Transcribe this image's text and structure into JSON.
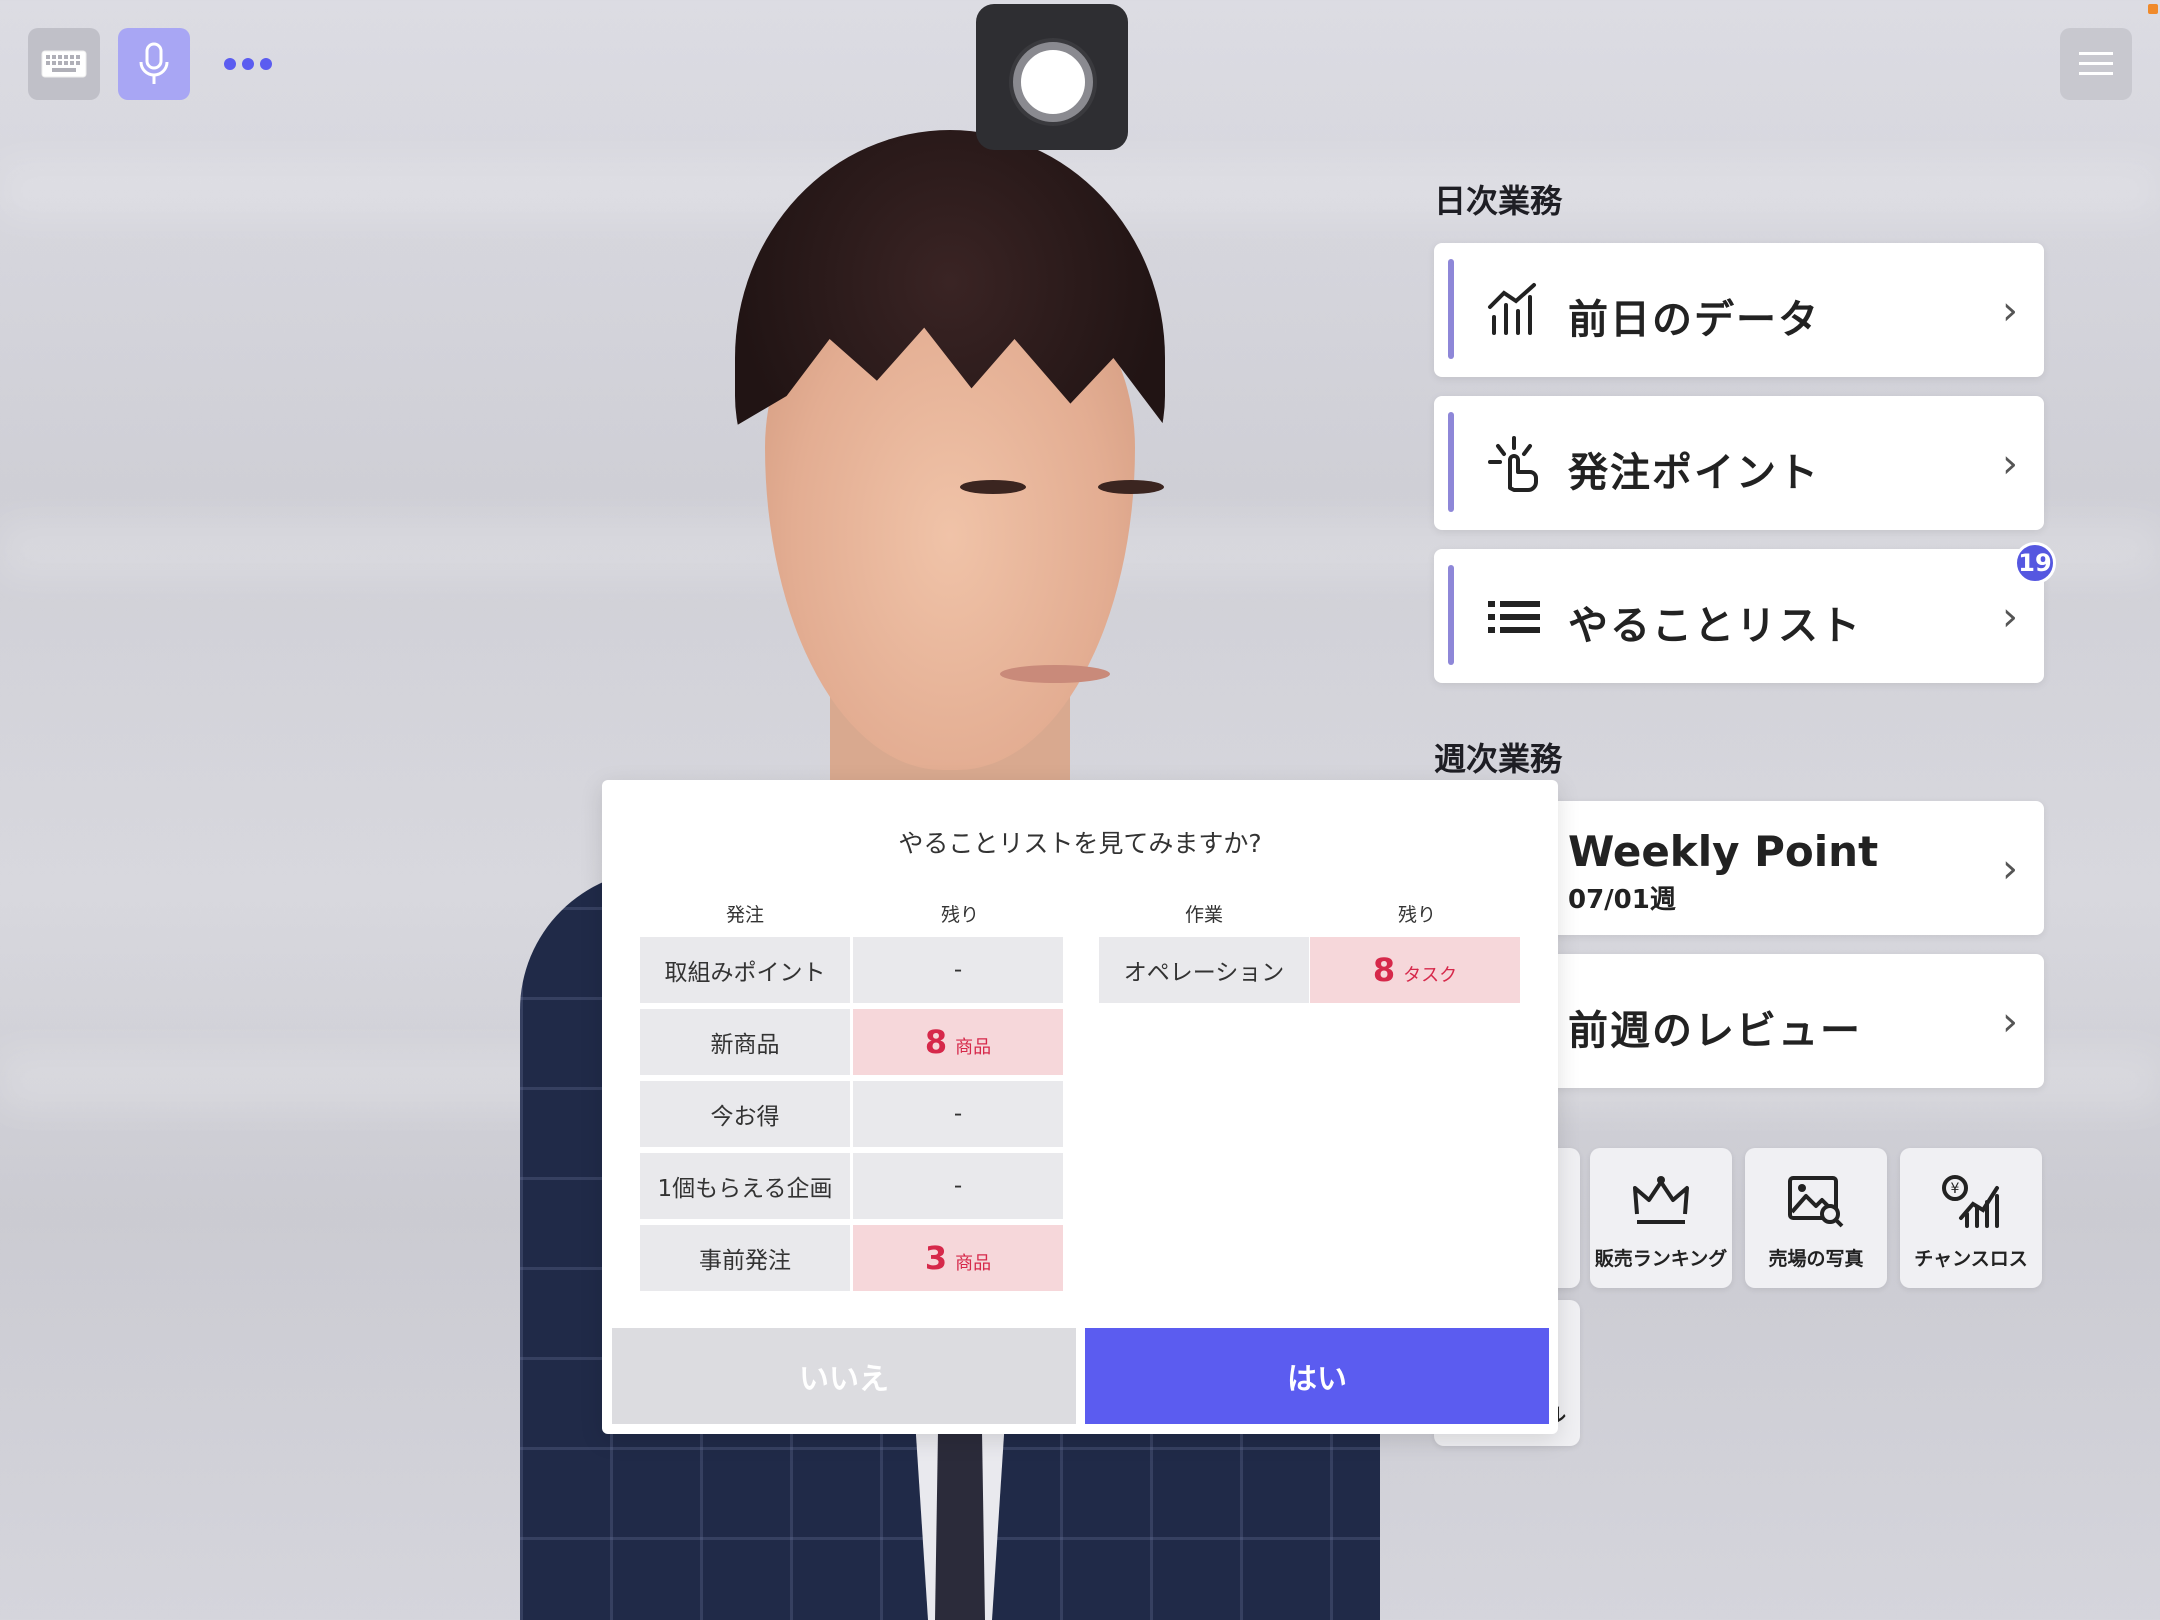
{
  "colors": {
    "accent": "#5b5cf0",
    "highlight_bg": "#f6d7da",
    "highlight_text": "#d6284a",
    "badge": "#5557e0"
  },
  "toolbar": {
    "keyboard_icon": "keyboard-icon",
    "mic_icon": "microphone-icon",
    "more_icon": "more-dots-icon",
    "menu_icon": "hamburger-menu-icon"
  },
  "daily": {
    "title": "日次業務",
    "items": [
      {
        "label": "前日のデータ",
        "icon": "bar-chart-icon"
      },
      {
        "label": "発注ポイント",
        "icon": "hand-point-icon"
      },
      {
        "label": "やることリスト",
        "icon": "list-icon",
        "badge": "19"
      }
    ]
  },
  "weekly": {
    "title": "週次業務",
    "items": [
      {
        "label": "Weekly Point",
        "sub": "07/01週"
      },
      {
        "label": "前週のレビュー"
      }
    ]
  },
  "tiles": [
    {
      "label": "販売ランキング",
      "icon": "crown-icon"
    },
    {
      "label": "売場の写真",
      "icon": "photo-search-icon"
    },
    {
      "label": "チャンスロス",
      "icon": "yen-chart-icon"
    }
  ],
  "tile_partial_text": "ル",
  "dialog": {
    "question": "やることリストを見てみますか?",
    "order_header": "発注",
    "remain_header_left": "残り",
    "work_header": "作業",
    "remain_header_right": "残り",
    "order_rows": [
      {
        "label": "取組みポイント",
        "value": "-"
      },
      {
        "label": "新商品",
        "num": "8",
        "unit": "商品"
      },
      {
        "label": "今お得",
        "value": "-"
      },
      {
        "label": "1個もらえる企画",
        "value": "-"
      },
      {
        "label": "事前発注",
        "num": "3",
        "unit": "商品"
      }
    ],
    "work_rows": [
      {
        "label": "オペレーション",
        "num": "8",
        "unit": "タスク"
      }
    ],
    "no_label": "いいえ",
    "yes_label": "はい"
  }
}
